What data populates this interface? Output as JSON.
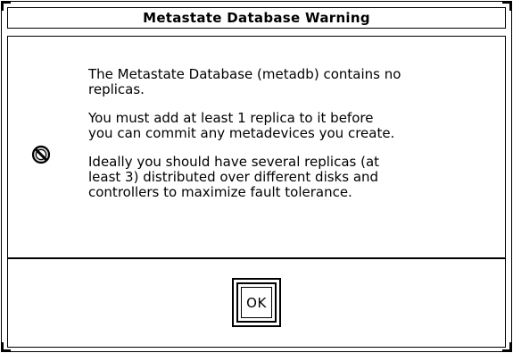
{
  "dialog": {
    "title": "Metastate Database Warning",
    "icon": "no-entry-icon",
    "messages": [
      "The Metastate Database (metadb) contains no\nreplicas.",
      "You must add at least 1 replica to it before\nyou can commit any metadevices you create.",
      "Ideally you should have several replicas (at\nleast 3) distributed over different disks and\ncontrollers to maximize fault tolerance."
    ],
    "ok_label": "OK"
  }
}
